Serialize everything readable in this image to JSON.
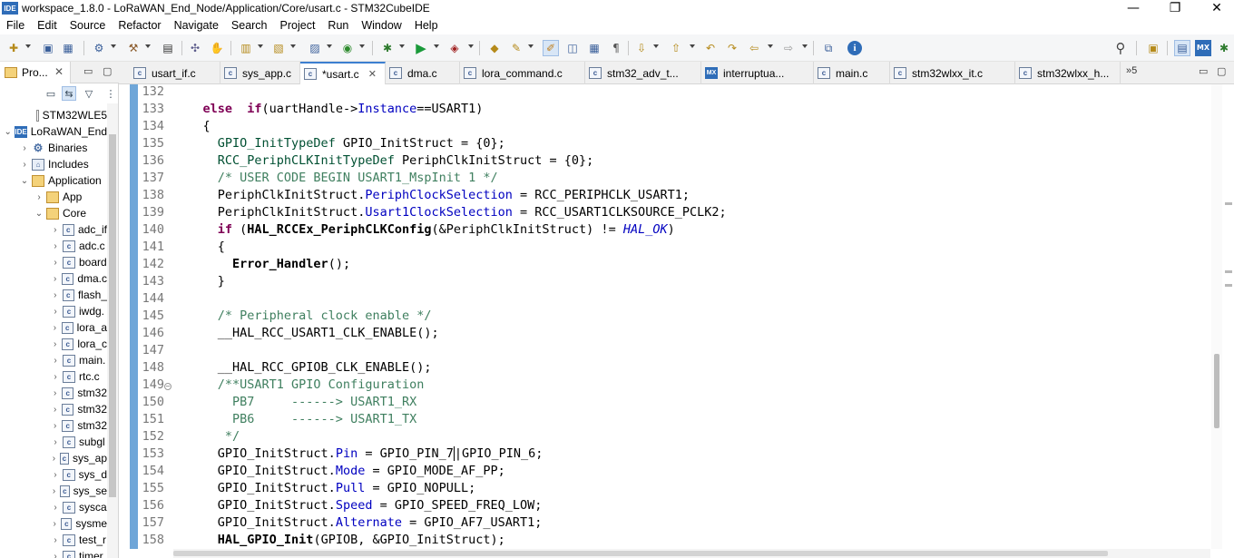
{
  "window": {
    "app_icon": "IDE",
    "title": "workspace_1.8.0 - LoRaWAN_End_Node/Application/Core/usart.c - STM32CubeIDE",
    "minimize": "—",
    "maximize": "❐",
    "close": "✕"
  },
  "menu": [
    "File",
    "Edit",
    "Source",
    "Refactor",
    "Navigate",
    "Search",
    "Project",
    "Run",
    "Window",
    "Help"
  ],
  "toolbar_icons": [
    {
      "name": "new-icon",
      "glyph": "✚"
    },
    {
      "name": "save-icon",
      "glyph": "▣"
    },
    {
      "name": "save-all-icon",
      "glyph": "▦"
    },
    {
      "name": "build-config-icon",
      "glyph": "⚙"
    },
    {
      "name": "build-icon",
      "glyph": "⚒"
    },
    {
      "name": "binary-icon",
      "glyph": "▤"
    },
    {
      "name": "debug-tools-icon",
      "glyph": "✣"
    },
    {
      "name": "device-config-icon",
      "glyph": "✋"
    },
    {
      "name": "new-project-icon",
      "glyph": "▥"
    },
    {
      "name": "open-folder-icon",
      "glyph": "▧"
    },
    {
      "name": "new-source-icon",
      "glyph": "▨"
    },
    {
      "name": "refresh-icon",
      "glyph": "◉"
    },
    {
      "name": "debug-icon",
      "glyph": "✱"
    },
    {
      "name": "run-icon",
      "glyph": "▶"
    },
    {
      "name": "external-tools-icon",
      "glyph": "◈"
    },
    {
      "name": "open-type-icon",
      "glyph": "◆"
    },
    {
      "name": "search-tool-icon",
      "glyph": "✎"
    },
    {
      "name": "highlight-icon",
      "glyph": "✐"
    },
    {
      "name": "block-select-icon",
      "glyph": "◫"
    },
    {
      "name": "show-whitespace-icon",
      "glyph": "▦"
    },
    {
      "name": "pilcrow-icon",
      "glyph": "¶"
    },
    {
      "name": "next-annotation-icon",
      "glyph": "⇩"
    },
    {
      "name": "prev-annotation-icon",
      "glyph": "⇧"
    },
    {
      "name": "last-edit-icon",
      "glyph": "↶"
    },
    {
      "name": "edit-location-icon",
      "glyph": "↷"
    },
    {
      "name": "back-icon",
      "glyph": "⇦"
    },
    {
      "name": "forward-icon",
      "glyph": "⇨"
    },
    {
      "name": "pin-editor-icon",
      "glyph": "⧉"
    },
    {
      "name": "info-icon",
      "glyph": "i"
    },
    {
      "name": "search-icon",
      "glyph": "⚲"
    },
    {
      "name": "open-perspective-icon",
      "glyph": "▣"
    },
    {
      "name": "cpp-perspective-icon",
      "glyph": "▤"
    },
    {
      "name": "mx-perspective-icon",
      "glyph": "MX"
    },
    {
      "name": "debug-perspective-icon",
      "glyph": "✱"
    }
  ],
  "left_panel": {
    "tab_label": "Pro...",
    "tab_close": "✕",
    "minimize": "▭",
    "maximize": "▢",
    "tools": [
      "▭",
      "⇆",
      "▽",
      "⋮"
    ],
    "tree": [
      {
        "label": "STM32WLE5",
        "icon": "ioc",
        "twisty": ""
      },
      {
        "label": "LoRaWAN_End",
        "icon": "ide",
        "twisty": "⌄"
      },
      {
        "label": "Binaries",
        "icon": "bin",
        "twisty": "›"
      },
      {
        "label": "Includes",
        "icon": "inc",
        "twisty": "›"
      },
      {
        "label": "Application",
        "icon": "folder",
        "twisty": "⌄"
      },
      {
        "label": "App",
        "icon": "folder",
        "twisty": "›"
      },
      {
        "label": "Core",
        "icon": "folder",
        "twisty": "⌄"
      },
      {
        "label": "adc_if",
        "icon": "c",
        "twisty": "›"
      },
      {
        "label": "adc.c",
        "icon": "c",
        "twisty": "›"
      },
      {
        "label": "board",
        "icon": "c",
        "twisty": "›"
      },
      {
        "label": "dma.c",
        "icon": "c",
        "twisty": "›"
      },
      {
        "label": "flash_",
        "icon": "c",
        "twisty": "›"
      },
      {
        "label": "iwdg.",
        "icon": "c",
        "twisty": "›"
      },
      {
        "label": "lora_a",
        "icon": "c",
        "twisty": "›"
      },
      {
        "label": "lora_c",
        "icon": "c",
        "twisty": "›"
      },
      {
        "label": "main.",
        "icon": "c",
        "twisty": "›"
      },
      {
        "label": "rtc.c",
        "icon": "c",
        "twisty": "›"
      },
      {
        "label": "stm32",
        "icon": "c",
        "twisty": "›"
      },
      {
        "label": "stm32",
        "icon": "c",
        "twisty": "›"
      },
      {
        "label": "stm32",
        "icon": "c",
        "twisty": "›"
      },
      {
        "label": "subgl",
        "icon": "c",
        "twisty": "›"
      },
      {
        "label": "sys_ap",
        "icon": "c",
        "twisty": "›"
      },
      {
        "label": "sys_d",
        "icon": "c",
        "twisty": "›"
      },
      {
        "label": "sys_se",
        "icon": "c",
        "twisty": "›"
      },
      {
        "label": "sysca",
        "icon": "c",
        "twisty": "›"
      },
      {
        "label": "sysme",
        "icon": "c",
        "twisty": "›"
      },
      {
        "label": "test_r",
        "icon": "c",
        "twisty": "›"
      },
      {
        "label": "timer",
        "icon": "c",
        "twisty": "›"
      }
    ]
  },
  "editor": {
    "tabs": [
      {
        "label": "usart_if.c",
        "icon": "c",
        "active": false
      },
      {
        "label": "sys_app.c",
        "icon": "c",
        "active": false
      },
      {
        "label": "*usart.c",
        "icon": "c",
        "active": true,
        "close": "✕"
      },
      {
        "label": "dma.c",
        "icon": "c",
        "active": false
      },
      {
        "label": "lora_command.c",
        "icon": "c",
        "active": false
      },
      {
        "label": "stm32_adv_t...",
        "icon": "c",
        "active": false
      },
      {
        "label": "interruptua...",
        "icon": "mx",
        "active": false
      },
      {
        "label": "main.c",
        "icon": "c",
        "active": false
      },
      {
        "label": "stm32wlxx_it.c",
        "icon": "c",
        "active": false
      },
      {
        "label": "stm32wlxx_h...",
        "icon": "c",
        "active": false
      }
    ],
    "tab_overflow": "»5",
    "minimize": "▭",
    "maximize": "▢",
    "fold_marker": "−",
    "line_numbers": [
      "132",
      "133",
      "134",
      "135",
      "136",
      "137",
      "138",
      "139",
      "140",
      "141",
      "142",
      "143",
      "144",
      "145",
      "146",
      "147",
      "148",
      "149",
      "150",
      "151",
      "152",
      "153",
      "154",
      "155",
      "156",
      "157",
      "158"
    ],
    "code_lines": [
      [],
      [
        [
          "kw",
          "    else  if"
        ],
        [
          "",
          "(uartHandle->"
        ],
        [
          "fld",
          "Instance"
        ],
        [
          "",
          "==USART1)"
        ]
      ],
      [
        [
          "",
          "    {"
        ]
      ],
      [
        [
          "ty",
          "      GPIO_InitTypeDef"
        ],
        [
          "",
          " GPIO_InitStruct = {0};"
        ]
      ],
      [
        [
          "ty",
          "      RCC_PeriphCLKInitTypeDef"
        ],
        [
          "",
          " PeriphClkInitStruct = {0};"
        ]
      ],
      [
        [
          "cmt",
          "      /* USER CODE BEGIN USART1_MspInit 1 */"
        ]
      ],
      [
        [
          "",
          "      PeriphClkInitStruct."
        ],
        [
          "fld",
          "PeriphClockSelection"
        ],
        [
          "",
          " = RCC_PERIPHCLK_USART1;"
        ]
      ],
      [
        [
          "",
          "      PeriphClkInitStruct."
        ],
        [
          "fld",
          "Usart1ClockSelection"
        ],
        [
          "",
          " = RCC_USART1CLKSOURCE_PCLK2;"
        ]
      ],
      [
        [
          "kw",
          "      if"
        ],
        [
          "",
          " ("
        ],
        [
          "fn",
          "HAL_RCCEx_PeriphCLKConfig"
        ],
        [
          "",
          "(&PeriphClkInitStruct) != "
        ],
        [
          "mac",
          "HAL_OK"
        ],
        [
          "",
          ")"
        ]
      ],
      [
        [
          "",
          "      {"
        ]
      ],
      [
        [
          "fn",
          "        Error_Handler"
        ],
        [
          "",
          "();"
        ]
      ],
      [
        [
          "",
          "      }"
        ]
      ],
      [],
      [
        [
          "cmt",
          "      /* Peripheral clock enable */"
        ]
      ],
      [
        [
          "",
          "      __HAL_RCC_USART1_CLK_ENABLE();"
        ]
      ],
      [],
      [
        [
          "",
          "      __HAL_RCC_GPIOB_CLK_ENABLE();"
        ]
      ],
      [
        [
          "cmt",
          "      /**USART1 GPIO Configuration"
        ]
      ],
      [
        [
          "cmt",
          "        PB7     ------> USART1_RX"
        ]
      ],
      [
        [
          "cmt",
          "        PB6     ------> USART1_TX"
        ]
      ],
      [
        [
          "cmt",
          "       */"
        ]
      ],
      [
        [
          "",
          "      GPIO_InitStruct."
        ],
        [
          "fld",
          "Pin"
        ],
        [
          "",
          " = GPIO_PIN_7"
        ],
        [
          "caret",
          "|GPIO_PIN_6;"
        ]
      ],
      [
        [
          "",
          "      GPIO_InitStruct."
        ],
        [
          "fld",
          "Mode"
        ],
        [
          "",
          " = GPIO_MODE_AF_PP;"
        ]
      ],
      [
        [
          "",
          "      GPIO_InitStruct."
        ],
        [
          "fld",
          "Pull"
        ],
        [
          "",
          " = GPIO_NOPULL;"
        ]
      ],
      [
        [
          "",
          "      GPIO_InitStruct."
        ],
        [
          "fld",
          "Speed"
        ],
        [
          "",
          " = GPIO_SPEED_FREQ_LOW;"
        ]
      ],
      [
        [
          "",
          "      GPIO_InitStruct."
        ],
        [
          "fld",
          "Alternate"
        ],
        [
          "",
          " = GPIO_AF7_USART1;"
        ]
      ],
      [
        [
          "fn",
          "      HAL_GPIO_Init"
        ],
        [
          "",
          "(GPIOB, &GPIO_InitStruct);"
        ]
      ]
    ]
  }
}
